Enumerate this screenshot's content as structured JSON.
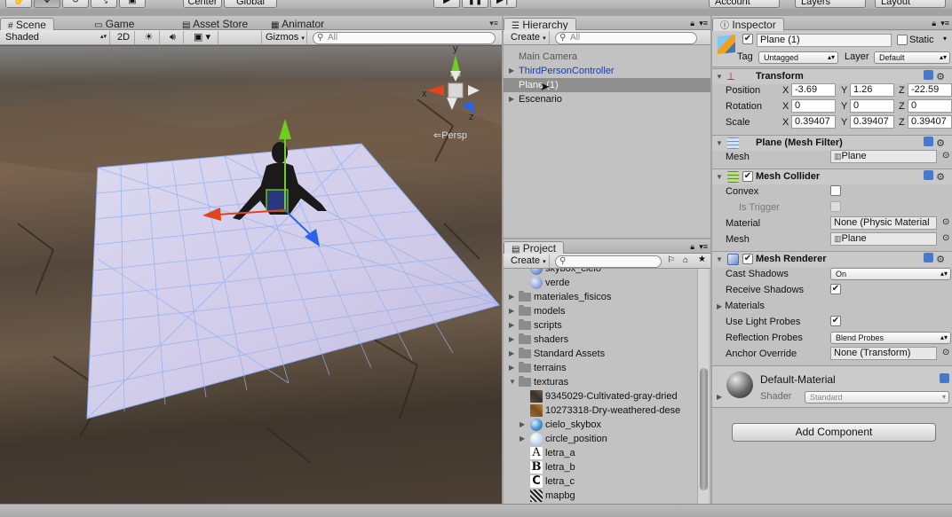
{
  "toolbar": {
    "pivot_label": "Center",
    "space_label": "Global",
    "account_label": "Account",
    "layers_label": "Layers",
    "layout_label": "Layout"
  },
  "scene": {
    "tabs": [
      "Scene",
      "Game",
      "Asset Store",
      "Animator"
    ],
    "shading_mode": "Shaded",
    "mode_2d": "2D",
    "gizmos_label": "Gizmos",
    "search_placeholder": "All",
    "persp_label": "Persp",
    "axis_x": "x",
    "axis_y": "y",
    "axis_z": "z"
  },
  "hierarchy": {
    "tab": "Hierarchy",
    "create_label": "Create",
    "search_placeholder": "All",
    "items": [
      "Main Camera",
      "ThirdPersonController",
      "Plane (1)",
      "Escenario"
    ]
  },
  "project": {
    "tab": "Project",
    "create_label": "Create",
    "items": [
      "skybox_cielo",
      "verde",
      "materiales_fisicos",
      "models",
      "scripts",
      "shaders",
      "Standard Assets",
      "terrains",
      "texturas",
      "9345029-Cultivated-gray-dried",
      "10273318-Dry-weathered-dese",
      "cielo_skybox",
      "circle_position",
      "letra_a",
      "letra_b",
      "letra_c",
      "mapbg"
    ]
  },
  "inspector": {
    "tab": "Inspector",
    "object_name": "Plane (1)",
    "static_label": "Static",
    "tag_label": "Tag",
    "tag_value": "Untagged",
    "layer_label": "Layer",
    "layer_value": "Default",
    "transform": {
      "title": "Transform",
      "position_label": "Position",
      "rotation_label": "Rotation",
      "scale_label": "Scale",
      "x": "X",
      "y": "Y",
      "z": "Z",
      "position": [
        "-3.69",
        "1.26",
        "-22.59"
      ],
      "rotation": [
        "0",
        "0",
        "0"
      ],
      "scale": [
        "0.39407",
        "0.39407",
        "0.39407"
      ]
    },
    "mesh_filter": {
      "title": "Plane (Mesh Filter)",
      "mesh_label": "Mesh",
      "mesh_value": "Plane"
    },
    "mesh_collider": {
      "title": "Mesh Collider",
      "convex_label": "Convex",
      "trigger_label": "Is Trigger",
      "material_label": "Material",
      "material_value": "None (Physic Material",
      "mesh_label": "Mesh",
      "mesh_value": "Plane"
    },
    "mesh_renderer": {
      "title": "Mesh Renderer",
      "cast_shadows_label": "Cast Shadows",
      "cast_shadows_value": "On",
      "receive_shadows_label": "Receive Shadows",
      "materials_label": "Materials",
      "light_probes_label": "Use Light Probes",
      "reflection_probes_label": "Reflection Probes",
      "reflection_probes_value": "Blend Probes",
      "anchor_override_label": "Anchor Override",
      "anchor_override_value": "None (Transform)"
    },
    "material": {
      "name": "Default-Material",
      "shader_label": "Shader",
      "shader_value": "Standard"
    },
    "add_component_label": "Add Component"
  },
  "colors": {
    "selection": "#8f8f8f",
    "link_blue": "#1a3cb0",
    "plane_fill": "#d6d2ee",
    "grid_line": "#8fb0f0",
    "axis_red": "#e0451c",
    "axis_green": "#6fcf1e",
    "axis_blue": "#2a63e8"
  }
}
